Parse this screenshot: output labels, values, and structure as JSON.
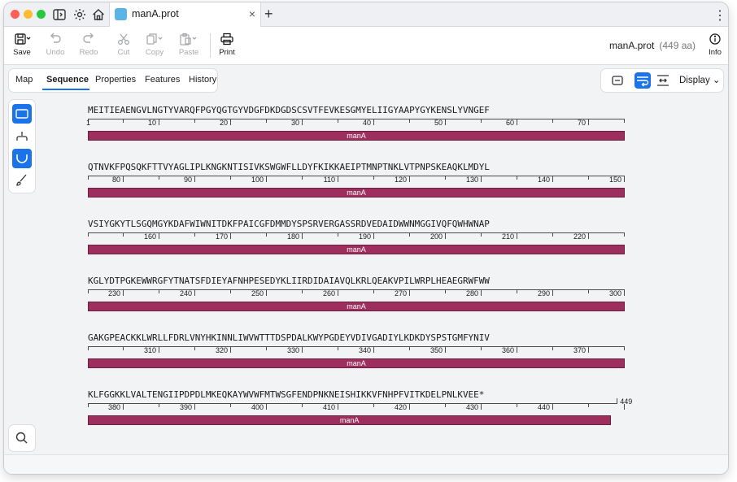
{
  "window": {
    "tab_title": "manA.prot",
    "close_glyph": "×",
    "newtab_glyph": "+",
    "menu_glyph": "⋮"
  },
  "toolbar": {
    "save": "Save",
    "undo": "Undo",
    "redo": "Redo",
    "cut": "Cut",
    "copy": "Copy",
    "paste": "Paste",
    "print": "Print",
    "info": "Info"
  },
  "document": {
    "name": "manA.prot",
    "length": "(449 aa)"
  },
  "subtabs": [
    "Map",
    "Sequence",
    "Properties",
    "Features",
    "History"
  ],
  "active_subtab": "Sequence",
  "display_menu": "Display",
  "colors": {
    "accent": "#1a73e8",
    "feature": "#9c2f5e",
    "traffic_red": "#ff5f57",
    "traffic_yellow": "#febc2e",
    "traffic_green": "#28c840"
  },
  "feature_label": "manA",
  "sequence_rows": [
    {
      "seq": "MEITIEAENGVLNGTYVARQFPGYQGTGYVDGFDKDGDSCSVTFEVKESGMYELIIGYAAPYGYKENSLYVNGEF",
      "start": 1
    },
    {
      "seq": "QTNVKFPQSQKFTTVYAGLIPLKNGKNTISIVKSWGWFLLDYFKIKKAEIPTMNPTNKLVTPNPSKEAQKLMDYL",
      "start": 76
    },
    {
      "seq": "VSIYGKYTLSGQMGYKDAFWIWNITDKFPAICGFDMMDYSPSRVERGASSRDVEDAIDWWNMGGIVQFQWHWNAP",
      "start": 151
    },
    {
      "seq": "KGLYDTPGKEWWRGFYTNATSFDIEYAFNHPESEDYKLIIRDIDAIAVQLKRLQEAKVPILWRPLHEAEGRWFWW",
      "start": 226
    },
    {
      "seq": "GAKGPEACKKLWRLLFDRLVNYHKINNLIWVWTTTDSPDALKWYPGDEYVDIVGADIYLKDKDYSPSTGMFYNIV",
      "start": 301
    },
    {
      "seq": "KLFGGKKLVALTENGIIPDPDLMKEQKAYWVWFMTWSGFENDPNKNEISHIKKVFNHPFVITKDELPNLKVEE*",
      "start": 376,
      "end_label": "449"
    }
  ],
  "row_tick_labels": [
    [
      "1",
      "10",
      "20",
      "30",
      "40",
      "50",
      "60",
      "70"
    ],
    [
      "80",
      "90",
      "100",
      "110",
      "120",
      "130",
      "140",
      "150"
    ],
    [
      "160",
      "170",
      "180",
      "190",
      "200",
      "210",
      "220"
    ],
    [
      "230",
      "240",
      "250",
      "260",
      "270",
      "280",
      "290",
      "300"
    ],
    [
      "310",
      "320",
      "330",
      "340",
      "350",
      "360",
      "370"
    ],
    [
      "380",
      "390",
      "400",
      "410",
      "420",
      "430",
      "440"
    ]
  ],
  "icons": {
    "save": "save-icon",
    "undo": "undo-icon",
    "redo": "redo-icon",
    "cut": "scissors-icon",
    "copy": "copy-icon",
    "paste": "paste-icon",
    "print": "printer-icon",
    "info": "info-icon",
    "sidebar": "sidebar-toggle-icon",
    "settings": "gear-icon",
    "home": "home-icon",
    "search": "search-icon"
  }
}
